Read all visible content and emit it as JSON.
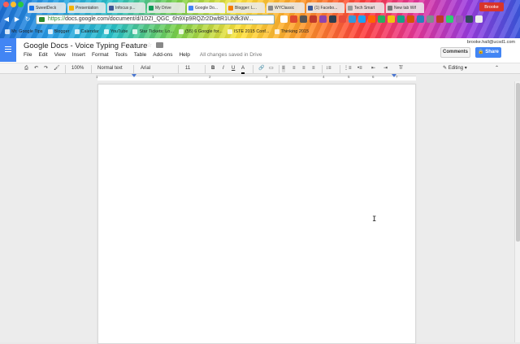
{
  "browser": {
    "tabs": [
      {
        "label": "SweetDeck",
        "color": "#1a73e8"
      },
      {
        "label": "Presentation",
        "color": "#f4b400"
      },
      {
        "label": "Infocus p...",
        "color": "#3b5998"
      },
      {
        "label": "My Drive",
        "color": "#0f9d58"
      },
      {
        "label": "Google Do...",
        "color": "#4285f4"
      },
      {
        "label": "Blogger: L...",
        "color": "#f57d00"
      },
      {
        "label": "WYClassic",
        "color": "#888888"
      },
      {
        "label": "(1) Facebo...",
        "color": "#3b5998"
      },
      {
        "label": "Tech Smart",
        "color": "#999999"
      },
      {
        "label": "New tab Wif",
        "color": "#777777"
      }
    ],
    "profile_name": "Brooke",
    "url_scheme": "https://",
    "url_rest": "docs.google.com/document/d/1DZI_QGC_6h9Xp9RQZr2DwltR1UNfk3W...",
    "bookmarks": [
      "Mr. Google Tips",
      "Blogger",
      "Calendar",
      "YouTube",
      "Star Tickets: Lo...",
      "(55) 6 Google for...",
      "ISTE 2015 Conf...",
      "Thinking 2015"
    ]
  },
  "docs": {
    "title": "Google Docs - Voice Typing Feature",
    "menu": [
      "File",
      "Edit",
      "View",
      "Insert",
      "Format",
      "Tools",
      "Table",
      "Add-ons",
      "Help"
    ],
    "saved_status": "All changes saved in Drive",
    "user_email": "brooke.hall@ucsd1.com",
    "comments_label": "Comments",
    "share_label": "Share"
  },
  "toolbar": {
    "zoom": "100%",
    "style": "Normal text",
    "font": "Arial",
    "size": "11",
    "bold": "B",
    "italic": "I",
    "underline": "U",
    "text_color": "A",
    "editing_label": "Editing"
  },
  "ruler": [
    "1",
    "1",
    "2",
    "3",
    "4",
    "5",
    "6",
    "7"
  ]
}
